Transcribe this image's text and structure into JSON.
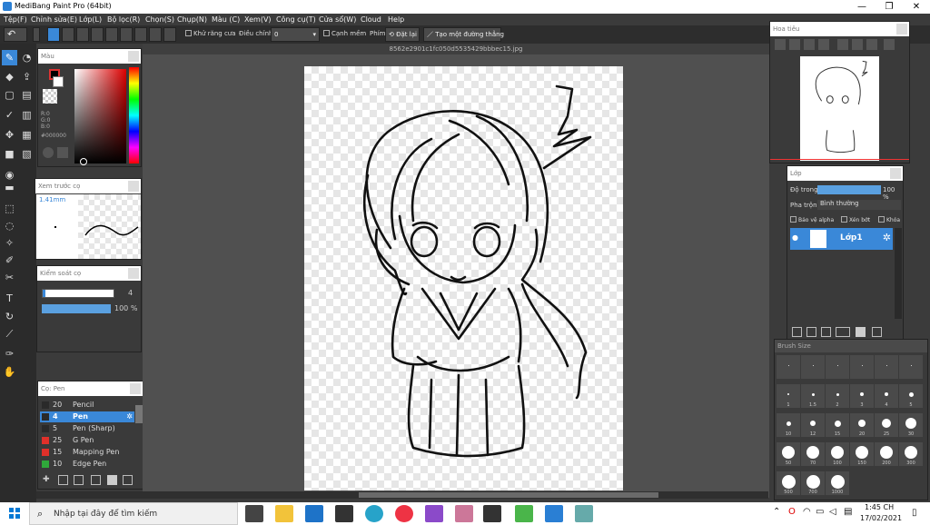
{
  "window": {
    "title": "MediBang Paint Pro (64bit)",
    "minimize": "—",
    "restore": "❐",
    "close": "✕"
  },
  "menu": [
    "Tệp(F)",
    "Chỉnh sửa(E)",
    "Lớp(L)",
    "Bộ lọc(R)",
    "Chọn(S)",
    "Chụp(N)",
    "Màu (C)",
    "Xem(V)",
    "Công cụ(T)",
    "Cửa sổ(W)",
    "Cloud",
    "Help"
  ],
  "toolbar": {
    "antialias_label": "Khử răng cưa",
    "correction_label": "Điều chỉnh",
    "correction_value": "0",
    "edge_label": "Cạnh mềm",
    "key_label": "Phím",
    "reset_label": "Đặt lại",
    "straight_label": "Tạo một đường thẳng"
  },
  "document": {
    "filename": "8562e2901c1fc050d5535429bbbec15.jpg"
  },
  "color_panel": {
    "title": "Màu",
    "r": "R:0",
    "g": "G:0",
    "b": "B:0",
    "hex": "#000000",
    "primary_color": "#000000",
    "secondary_color": "#ffffff"
  },
  "brush_preview_panel": {
    "title": "Xem trước cọ",
    "size": "1.41mm"
  },
  "brush_control_panel": {
    "title": "Kiểm soát cọ",
    "size_value": "4",
    "opacity_value": "100 %"
  },
  "brush_list_panel": {
    "title": "Cọ: Pen",
    "items": [
      {
        "size": "20",
        "name": "Pencil",
        "color": "#2a2a2a"
      },
      {
        "size": "4",
        "name": "Pen",
        "color": "#2a2a2a"
      },
      {
        "size": "5",
        "name": "Pen (Sharp)",
        "color": "#2a2a2a"
      },
      {
        "size": "25",
        "name": "G Pen",
        "color": "#e0302a"
      },
      {
        "size": "15",
        "name": "Mapping Pen",
        "color": "#e0302a"
      },
      {
        "size": "10",
        "name": "Edge Pen",
        "color": "#2fa83a"
      }
    ]
  },
  "navigator_panel": {
    "title": "Hoa tiêu"
  },
  "layer_panel": {
    "title": "Lớp",
    "opacity_label": "Độ trong",
    "opacity_value": "100 %",
    "opacity_fraction": 1.0,
    "blend_label": "Pha trộn",
    "blend_value": "Bình thường",
    "protect_alpha": "Bảo vệ alpha",
    "clipping": "Xén bớt",
    "lock": "Khóa",
    "layers": [
      {
        "name": "Lớp1"
      }
    ]
  },
  "brush_size_panel": {
    "title": "Brush Size",
    "sizes": [
      "",
      "",
      "",
      "",
      "",
      "",
      "1",
      "1.5",
      "2",
      "3",
      "4",
      "5",
      "10",
      "12",
      "15",
      "20",
      "25",
      "30",
      "50",
      "70",
      "100",
      "150",
      "200",
      "300",
      "500",
      "700",
      "1000"
    ]
  },
  "taskbar": {
    "search_placeholder": "Nhập tại đây để tìm kiếm",
    "time": "1:45 CH",
    "date": "17/02/2021"
  }
}
